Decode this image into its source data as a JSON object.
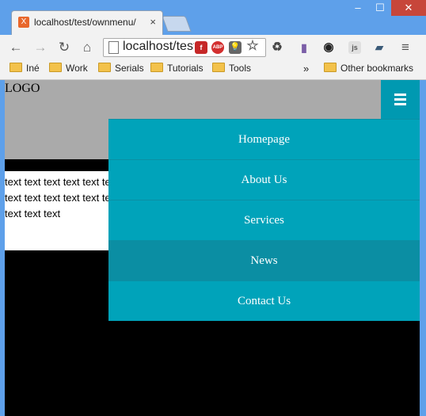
{
  "browser": {
    "tab_title": "localhost/test/ownmenu/",
    "tab_close": "×",
    "favicon_glyph": "X",
    "window_controls": {
      "minimize": "–",
      "maximize": "☐",
      "close": "✕"
    },
    "nav": {
      "back": "←",
      "forward": "→",
      "reload": "↻",
      "home": "⌂",
      "menu": "≡"
    },
    "url": "localhost/test/ownmenu/",
    "star": "☆",
    "extensions": [
      {
        "name": "flash-icon",
        "color": "#c62828",
        "glyph": "f"
      },
      {
        "name": "adblock-icon",
        "color": "#d32f2f",
        "glyph": "ABP"
      },
      {
        "name": "bulb-icon",
        "color": "#666666",
        "glyph": "💡"
      },
      {
        "name": "recycle-icon",
        "color": "#444444",
        "glyph": "♻"
      },
      {
        "name": "phone-icon",
        "color": "#7b5ea7",
        "glyph": "▮"
      },
      {
        "name": "color-wheel-icon",
        "color": "#222222",
        "glyph": "◉"
      },
      {
        "name": "js-icon",
        "color": "#8a8a8a",
        "glyph": "js"
      },
      {
        "name": "book-icon",
        "color": "#3a5a78",
        "glyph": "▰"
      }
    ],
    "bookmarks": [
      "Iné",
      "Work",
      "Serials",
      "Tutorials",
      "Tools"
    ],
    "bookmarks_overflow": "»",
    "other_bookmarks": "Other bookmarks"
  },
  "page": {
    "logo": "LOGO",
    "content_text": "text text text text text text text text text text text text text text text",
    "menu": [
      {
        "label": "Homepage",
        "active": false
      },
      {
        "label": "About Us",
        "active": false
      },
      {
        "label": "Services",
        "active": false
      },
      {
        "label": "News",
        "active": true
      },
      {
        "label": "Contact Us",
        "active": false
      }
    ]
  }
}
